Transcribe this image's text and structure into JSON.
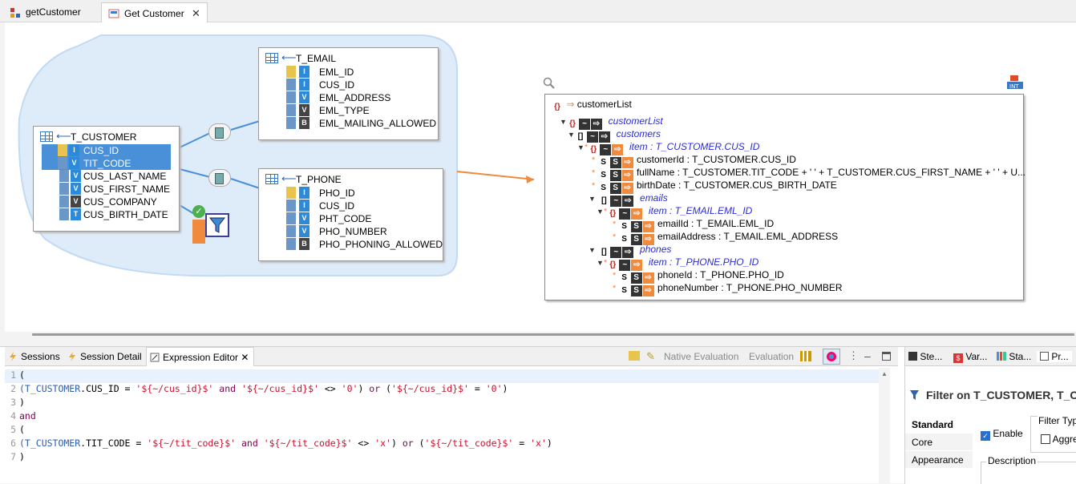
{
  "editor_tabs": [
    {
      "label": "getCustomer"
    },
    {
      "label": "Get Customer",
      "close": "✕"
    }
  ],
  "tables": {
    "customer": {
      "name": "T_CUSTOMER",
      "columns": [
        "CUS_ID",
        "TIT_CODE",
        "CUS_LAST_NAME",
        "CUS_FIRST_NAME",
        "CUS_COMPANY",
        "CUS_BIRTH_DATE"
      ]
    },
    "email": {
      "name": "T_EMAIL",
      "columns": [
        "EML_ID",
        "CUS_ID",
        "EML_ADDRESS",
        "EML_TYPE",
        "EML_MAILING_ALLOWED"
      ]
    },
    "phone": {
      "name": "T_PHONE",
      "columns": [
        "PHO_ID",
        "CUS_ID",
        "PHT_CODE",
        "PHO_NUMBER",
        "PHO_PHONING_ALLOWED"
      ]
    }
  },
  "json_tree": {
    "root": "customerList",
    "nodes": [
      {
        "label": "customerList",
        "badge": "{}"
      },
      {
        "label": "customers",
        "badge": "[]"
      },
      {
        "label": "item : T_CUSTOMER.CUS_ID",
        "badge": "{}"
      },
      {
        "label": "customerId : T_CUSTOMER.CUS_ID",
        "badge": "S"
      },
      {
        "label": "fullName : T_CUSTOMER.TIT_CODE + ' ' + T_CUSTOMER.CUS_FIRST_NAME + ' ' + U...",
        "badge": "S"
      },
      {
        "label": "birthDate : T_CUSTOMER.CUS_BIRTH_DATE",
        "badge": "S"
      },
      {
        "label": "emails",
        "badge": "[]"
      },
      {
        "label": "item : T_EMAIL.EML_ID",
        "badge": "{}"
      },
      {
        "label": "emailId : T_EMAIL.EML_ID",
        "badge": "S"
      },
      {
        "label": "emailAddress : T_EMAIL.EML_ADDRESS",
        "badge": "S"
      },
      {
        "label": "phones",
        "badge": "[]"
      },
      {
        "label": "item : T_PHONE.PHO_ID",
        "badge": "{}"
      },
      {
        "label": "phoneId : T_PHONE.PHO_ID",
        "badge": "S"
      },
      {
        "label": "phoneNumber : T_PHONE.PHO_NUMBER",
        "badge": "S"
      }
    ]
  },
  "bottom_tabs": [
    {
      "label": "Sessions"
    },
    {
      "label": "Session Detail"
    },
    {
      "label": "Expression Editor",
      "close": "✕"
    }
  ],
  "toolbar": {
    "native_eval": "Native Evaluation",
    "eval": "Evaluation"
  },
  "code_lines": [
    {
      "n": "1",
      "parts": [
        [
          "op",
          "("
        ]
      ]
    },
    {
      "n": "2",
      "parts": [
        [
          "tbn",
          "(T_CUSTOMER"
        ],
        [
          "op",
          ".CUS_ID = "
        ],
        [
          "str",
          "'${~/cus_id}$'"
        ],
        [
          "op",
          " "
        ],
        [
          "kw",
          "and"
        ],
        [
          "op",
          " "
        ],
        [
          "str",
          "'${~/cus_id}$'"
        ],
        [
          "op",
          " <> "
        ],
        [
          "str",
          "'0'"
        ],
        [
          "op",
          ") "
        ],
        [
          "kw",
          "or"
        ],
        [
          "op",
          " ("
        ],
        [
          "str",
          "'${~/cus_id}$'"
        ],
        [
          "op",
          " = "
        ],
        [
          "str",
          "'0'"
        ],
        [
          "op",
          ")"
        ]
      ]
    },
    {
      "n": "3",
      "parts": [
        [
          "op",
          ")"
        ]
      ]
    },
    {
      "n": "4",
      "parts": [
        [
          "kw",
          "and"
        ]
      ]
    },
    {
      "n": "5",
      "parts": [
        [
          "op",
          "("
        ]
      ]
    },
    {
      "n": "6",
      "parts": [
        [
          "tbn",
          "(T_CUSTOMER"
        ],
        [
          "op",
          ".TIT_CODE = "
        ],
        [
          "str",
          "'${~/tit_code}$'"
        ],
        [
          "op",
          " "
        ],
        [
          "kw",
          "and"
        ],
        [
          "op",
          " "
        ],
        [
          "str",
          "'${~/tit_code}$'"
        ],
        [
          "op",
          " <> "
        ],
        [
          "str",
          "'x'"
        ],
        [
          "op",
          ") "
        ],
        [
          "kw",
          "or"
        ],
        [
          "op",
          " ("
        ],
        [
          "str",
          "'${~/tit_code}$'"
        ],
        [
          "op",
          " = "
        ],
        [
          "str",
          "'x'"
        ],
        [
          "op",
          ")"
        ]
      ]
    },
    {
      "n": "7",
      "parts": [
        [
          "op",
          ")"
        ]
      ]
    }
  ],
  "right_panel": {
    "tabs": [
      "Ste...",
      "Var...",
      "Sta...",
      "Pr..."
    ],
    "title": "Filter on T_CUSTOMER, T_C",
    "nav": [
      "Standard",
      "Core",
      "Appearance"
    ],
    "enable_label": "Enable",
    "filter_type_label": "Filter Typ",
    "aggregate_label": "Aggre",
    "description_label": "Description"
  }
}
